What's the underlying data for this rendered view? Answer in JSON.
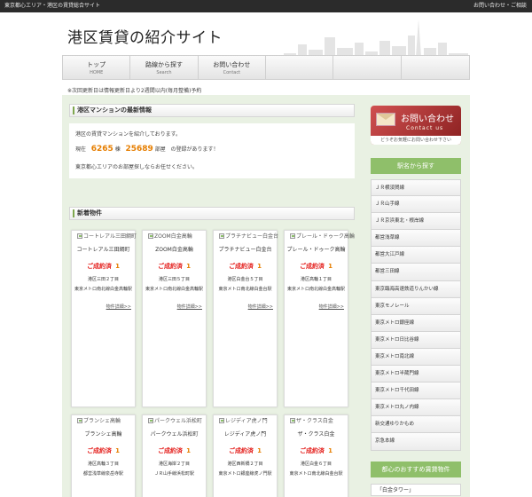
{
  "topbar": {
    "left": "東京都心エリア・港区の賃貸総合サイト",
    "right": "お問い合わせ・ご相談"
  },
  "header": {
    "title": "港区賃貸の紹介サイト"
  },
  "nav": [
    {
      "jp": "トップ",
      "en": "HOME"
    },
    {
      "jp": "路線から探す",
      "en": "Search"
    },
    {
      "jp": "お問い合わせ",
      "en": "Contact"
    },
    {
      "jp": "",
      "en": ""
    },
    {
      "jp": "",
      "en": ""
    },
    {
      "jp": "",
      "en": ""
    }
  ],
  "notice": "※次回更新日は情報更新日より2週間以内(毎月整備)予約",
  "latest": {
    "heading": "港区マンションの最新情報",
    "line1": "港区の賃貸マンションを紹介しております。",
    "line2_pre": "現在",
    "count_buildings": "6265",
    "unit_buildings": "棟",
    "count_units": "25689",
    "unit_units": "部屋",
    "line2_post": "の登録があります！",
    "line3": "東京都心エリアのお部屋探しならお任せください。"
  },
  "new_heading": "新着物件",
  "deal_label": "ご成約済",
  "more_label": "物件詳細>>",
  "cards": [
    {
      "img_alt": "コートレアル三田綱町",
      "name": "コートレアル三田綱町",
      "deals": "1",
      "addr": "港区三田２丁目",
      "station": "東京メトロ南北線白金高輪駅"
    },
    {
      "img_alt": "ZOOM白金高輪",
      "name": "ZOOM白金高輪",
      "deals": "1",
      "addr": "港区三田５丁目",
      "station": "東京メトロ南北線白金高輪駅"
    },
    {
      "img_alt": "プラチナビュー白金台",
      "name": "プラチナビュー白金台",
      "deals": "1",
      "addr": "港区白金台５丁目",
      "station": "東京メトロ南北線白金台駅"
    },
    {
      "img_alt": "プレール・ドゥーク高輪",
      "name": "プレール・ドゥーク高輪",
      "deals": "1",
      "addr": "港区高輪１丁目",
      "station": "東京メトロ南北線白金高輪駅"
    },
    {
      "img_alt": "ブランシェ高輪",
      "name": "ブランシェ高輪",
      "deals": "1",
      "addr": "港区高輪３丁目",
      "station": "都営浅草線泉岳寺駅"
    },
    {
      "img_alt": "パークウェル浜松町",
      "name": "パークウェル浜松町",
      "deals": "1",
      "addr": "港区海岸２丁目",
      "station": "ＪＲ山手線浜松町駅"
    },
    {
      "img_alt": "レジディア虎ノ門",
      "name": "レジディア虎ノ門",
      "deals": "1",
      "addr": "港区西新橋２丁目",
      "station": "東京メトロ銀座線虎ノ門駅"
    },
    {
      "img_alt": "ザ・クラス白金",
      "name": "ザ・クラス白金",
      "deals": "1",
      "addr": "港区白金６丁目",
      "station": "東京メトロ南北線白金台駅"
    }
  ],
  "sidebar": {
    "contact_jp": "お問い合わせ",
    "contact_en": "Contact us",
    "contact_sub": "どうぞお気軽にお問い合わせ下さい",
    "station_heading": "駅名から探す",
    "stations": [
      "ＪＲ横須賀線",
      "ＪＲ山手線",
      "ＪＲ京浜東北・根岸線",
      "都営浅草線",
      "都営大江戸線",
      "都営三田線",
      "東京臨海高速鉄道りんかい線",
      "東京モノレール",
      "東京メトロ銀座線",
      "東京メトロ日比谷線",
      "東京メトロ南北線",
      "東京メトロ半蔵門線",
      "東京メトロ千代田線",
      "東京メトロ丸ノ内線",
      "新交通ゆりかもめ",
      "京急本線"
    ],
    "rec_heading": "都心のおすすめ賃貸物件",
    "rec_first": "「白金タワー」"
  }
}
